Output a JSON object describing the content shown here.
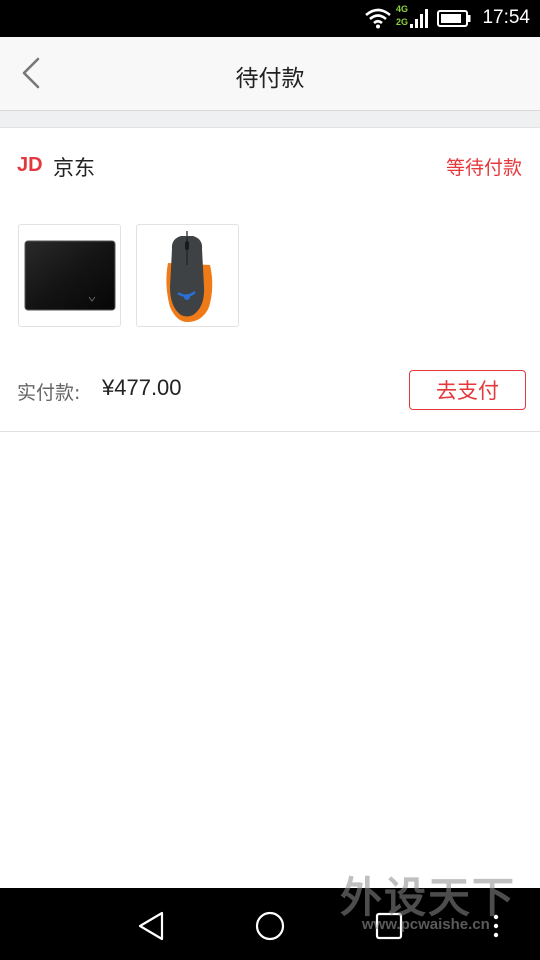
{
  "status_bar": {
    "time": "17:54",
    "network_labels": [
      "4G",
      "2G"
    ],
    "icons": [
      "wifi-icon",
      "signal-icon",
      "battery-icon"
    ]
  },
  "header": {
    "title": "待付款",
    "back_icon": "chevron-left-icon"
  },
  "order": {
    "shop_logo": "JD",
    "shop_name": "京东",
    "status": "等待付款",
    "products": [
      {
        "name": "mousepad",
        "image": "mousepad-image"
      },
      {
        "name": "mouse",
        "image": "mouse-image"
      }
    ],
    "price_label": "实付款:",
    "price_value": "¥477.00",
    "pay_button": "去支付"
  },
  "colors": {
    "accent": "#e4393c",
    "statusbar": "#000000",
    "appbar": "#f8f8f8",
    "band": "#eef0f1"
  },
  "system_nav": {
    "icons": [
      "back-triangle-icon",
      "home-circle-icon",
      "recent-square-icon",
      "menu-dots-icon"
    ]
  },
  "watermark": {
    "main": "外设天下",
    "sub": "www.pcwaishe.cn"
  }
}
